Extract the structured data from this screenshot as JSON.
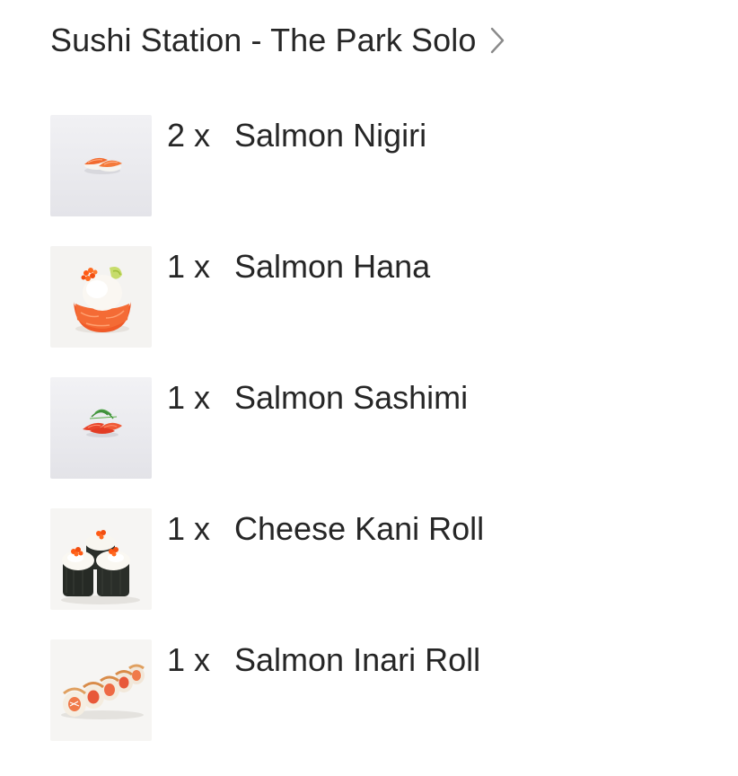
{
  "store": {
    "name": "Sushi Station - The Park Solo",
    "chevron_icon": "chevron-right-icon"
  },
  "items": [
    {
      "qty": "2 x",
      "name": "Salmon Nigiri",
      "thumb": "salmon-nigiri-image"
    },
    {
      "qty": "1 x",
      "name": "Salmon Hana",
      "thumb": "salmon-hana-image"
    },
    {
      "qty": "1 x",
      "name": "Salmon Sashimi",
      "thumb": "salmon-sashimi-image"
    },
    {
      "qty": "1 x",
      "name": "Cheese Kani Roll",
      "thumb": "cheese-kani-roll-image"
    },
    {
      "qty": "1 x",
      "name": "Salmon Inari Roll",
      "thumb": "salmon-inari-roll-image"
    }
  ]
}
